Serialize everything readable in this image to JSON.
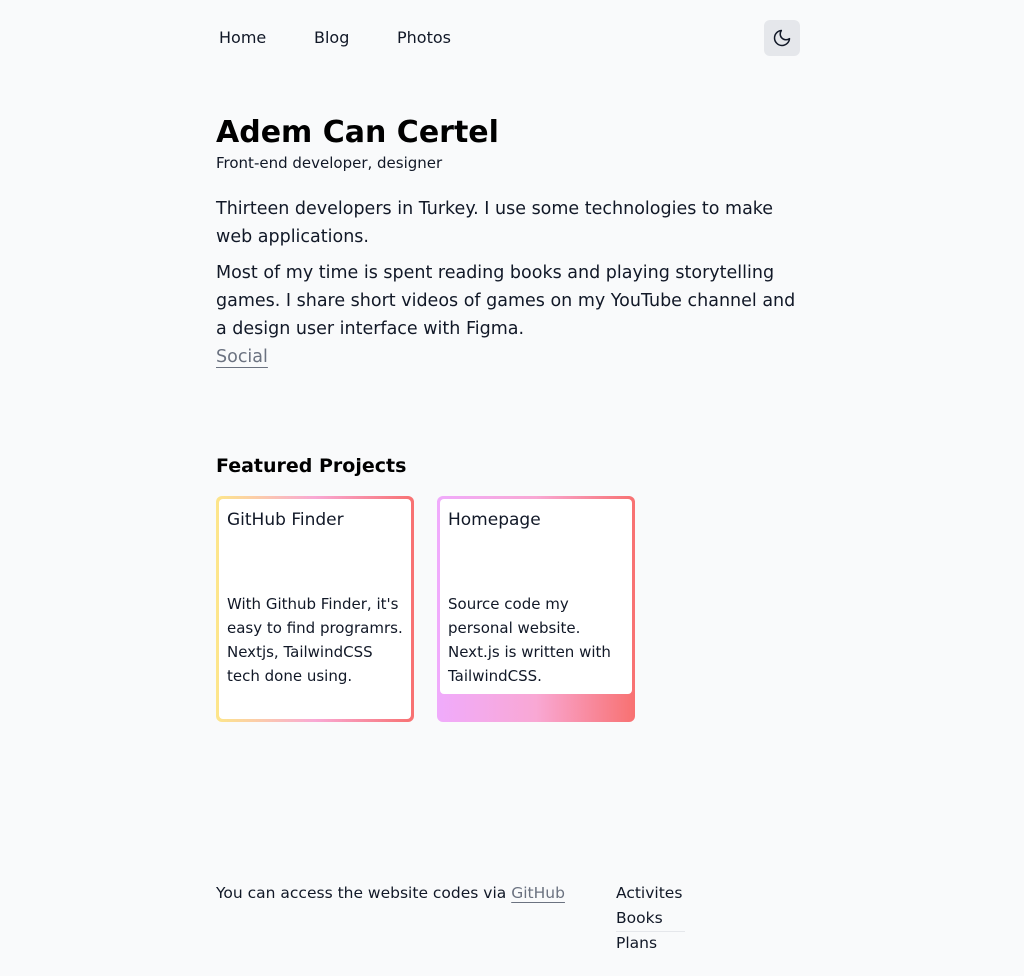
{
  "nav": {
    "home": "Home",
    "blog": "Blog",
    "photos": "Photos",
    "theme_icon": "moon-icon"
  },
  "intro": {
    "name": "Adem Can Certel",
    "role": "Front-end developer, designer",
    "bio_1": "Thirteen developers in Turkey. I use some technologies to make web applications.",
    "bio_2": "Most of my time is spent reading books and playing storytelling games. I share short videos of games on my YouTube channel and a design user interface with Figma.",
    "social_link": "Social"
  },
  "featured": {
    "title": "Featured Projects",
    "projects": [
      {
        "title": "GitHub Finder",
        "description": "With Github Finder, it's easy to find programrs. Nextjs, TailwindCSS tech done using."
      },
      {
        "title": "Homepage",
        "description": "Source code my personal website. Next.js is written with TailwindCSS."
      }
    ]
  },
  "footer": {
    "text": "You can access the website codes via",
    "github_link": "GitHub",
    "links": [
      "Activites",
      "Books",
      "Plans"
    ]
  },
  "colors": {
    "background": "#f9fafb",
    "text": "#111827",
    "muted_link": "#6b7280",
    "toggle_bg": "#e5e7eb",
    "card_1_gradient": [
      "#fde68a",
      "#f9a8d4",
      "#f87171"
    ],
    "card_2_gradient": [
      "#f0abfc",
      "#f9a8d4",
      "#f87171"
    ]
  }
}
